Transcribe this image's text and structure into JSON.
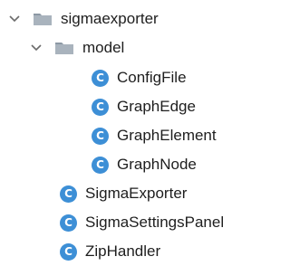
{
  "tree": {
    "root": {
      "label": "sigmaexporter",
      "icon": "folder-icon",
      "expanded": true
    },
    "package": {
      "label": "model",
      "icon": "folder-icon",
      "expanded": true
    },
    "package_classes": [
      {
        "label": "ConfigFile",
        "icon": "class-icon"
      },
      {
        "label": "GraphEdge",
        "icon": "class-icon"
      },
      {
        "label": "GraphElement",
        "icon": "class-icon"
      },
      {
        "label": "GraphNode",
        "icon": "class-icon"
      }
    ],
    "root_classes": [
      {
        "label": "SigmaExporter",
        "icon": "class-icon"
      },
      {
        "label": "SigmaSettingsPanel",
        "icon": "class-icon"
      },
      {
        "label": "ZipHandler",
        "icon": "class-icon"
      }
    ],
    "class_icon_glyph": "C"
  },
  "colors": {
    "class_icon": "#3d8fd6",
    "folder": "#a9b3bd",
    "folder_tab": "#8c98a4",
    "chevron": "#6b6b6b",
    "text": "#1e1e1e"
  }
}
